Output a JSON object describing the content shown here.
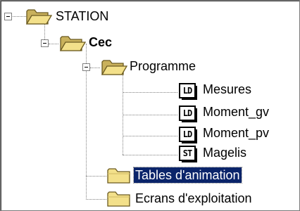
{
  "tree": {
    "root": {
      "label": "STATION",
      "icon": "open-folder-icon",
      "expanded": true
    },
    "cec": {
      "label": "Cec",
      "icon": "open-folder-icon",
      "expanded": true
    },
    "programme": {
      "label": "Programme",
      "icon": "open-folder-icon",
      "expanded": true
    },
    "sections": [
      {
        "label": "Mesures",
        "icon": "ld-section-icon",
        "badge": "LD"
      },
      {
        "label": "Moment_gv",
        "icon": "ld-section-icon",
        "badge": "LD"
      },
      {
        "label": "Moment_pv",
        "icon": "ld-section-icon",
        "badge": "LD"
      },
      {
        "label": "Magelis",
        "icon": "st-section-icon",
        "badge": "ST"
      }
    ],
    "tables": {
      "label": "Tables d'animation",
      "icon": "folder-icon",
      "selected": true
    },
    "ecrans": {
      "label": "Ecrans d'exploitation",
      "icon": "folder-icon"
    }
  },
  "colors": {
    "folder_yellow": "#f5e28a",
    "folder_dark": "#8a7a3a",
    "selection": "#0a246a"
  }
}
